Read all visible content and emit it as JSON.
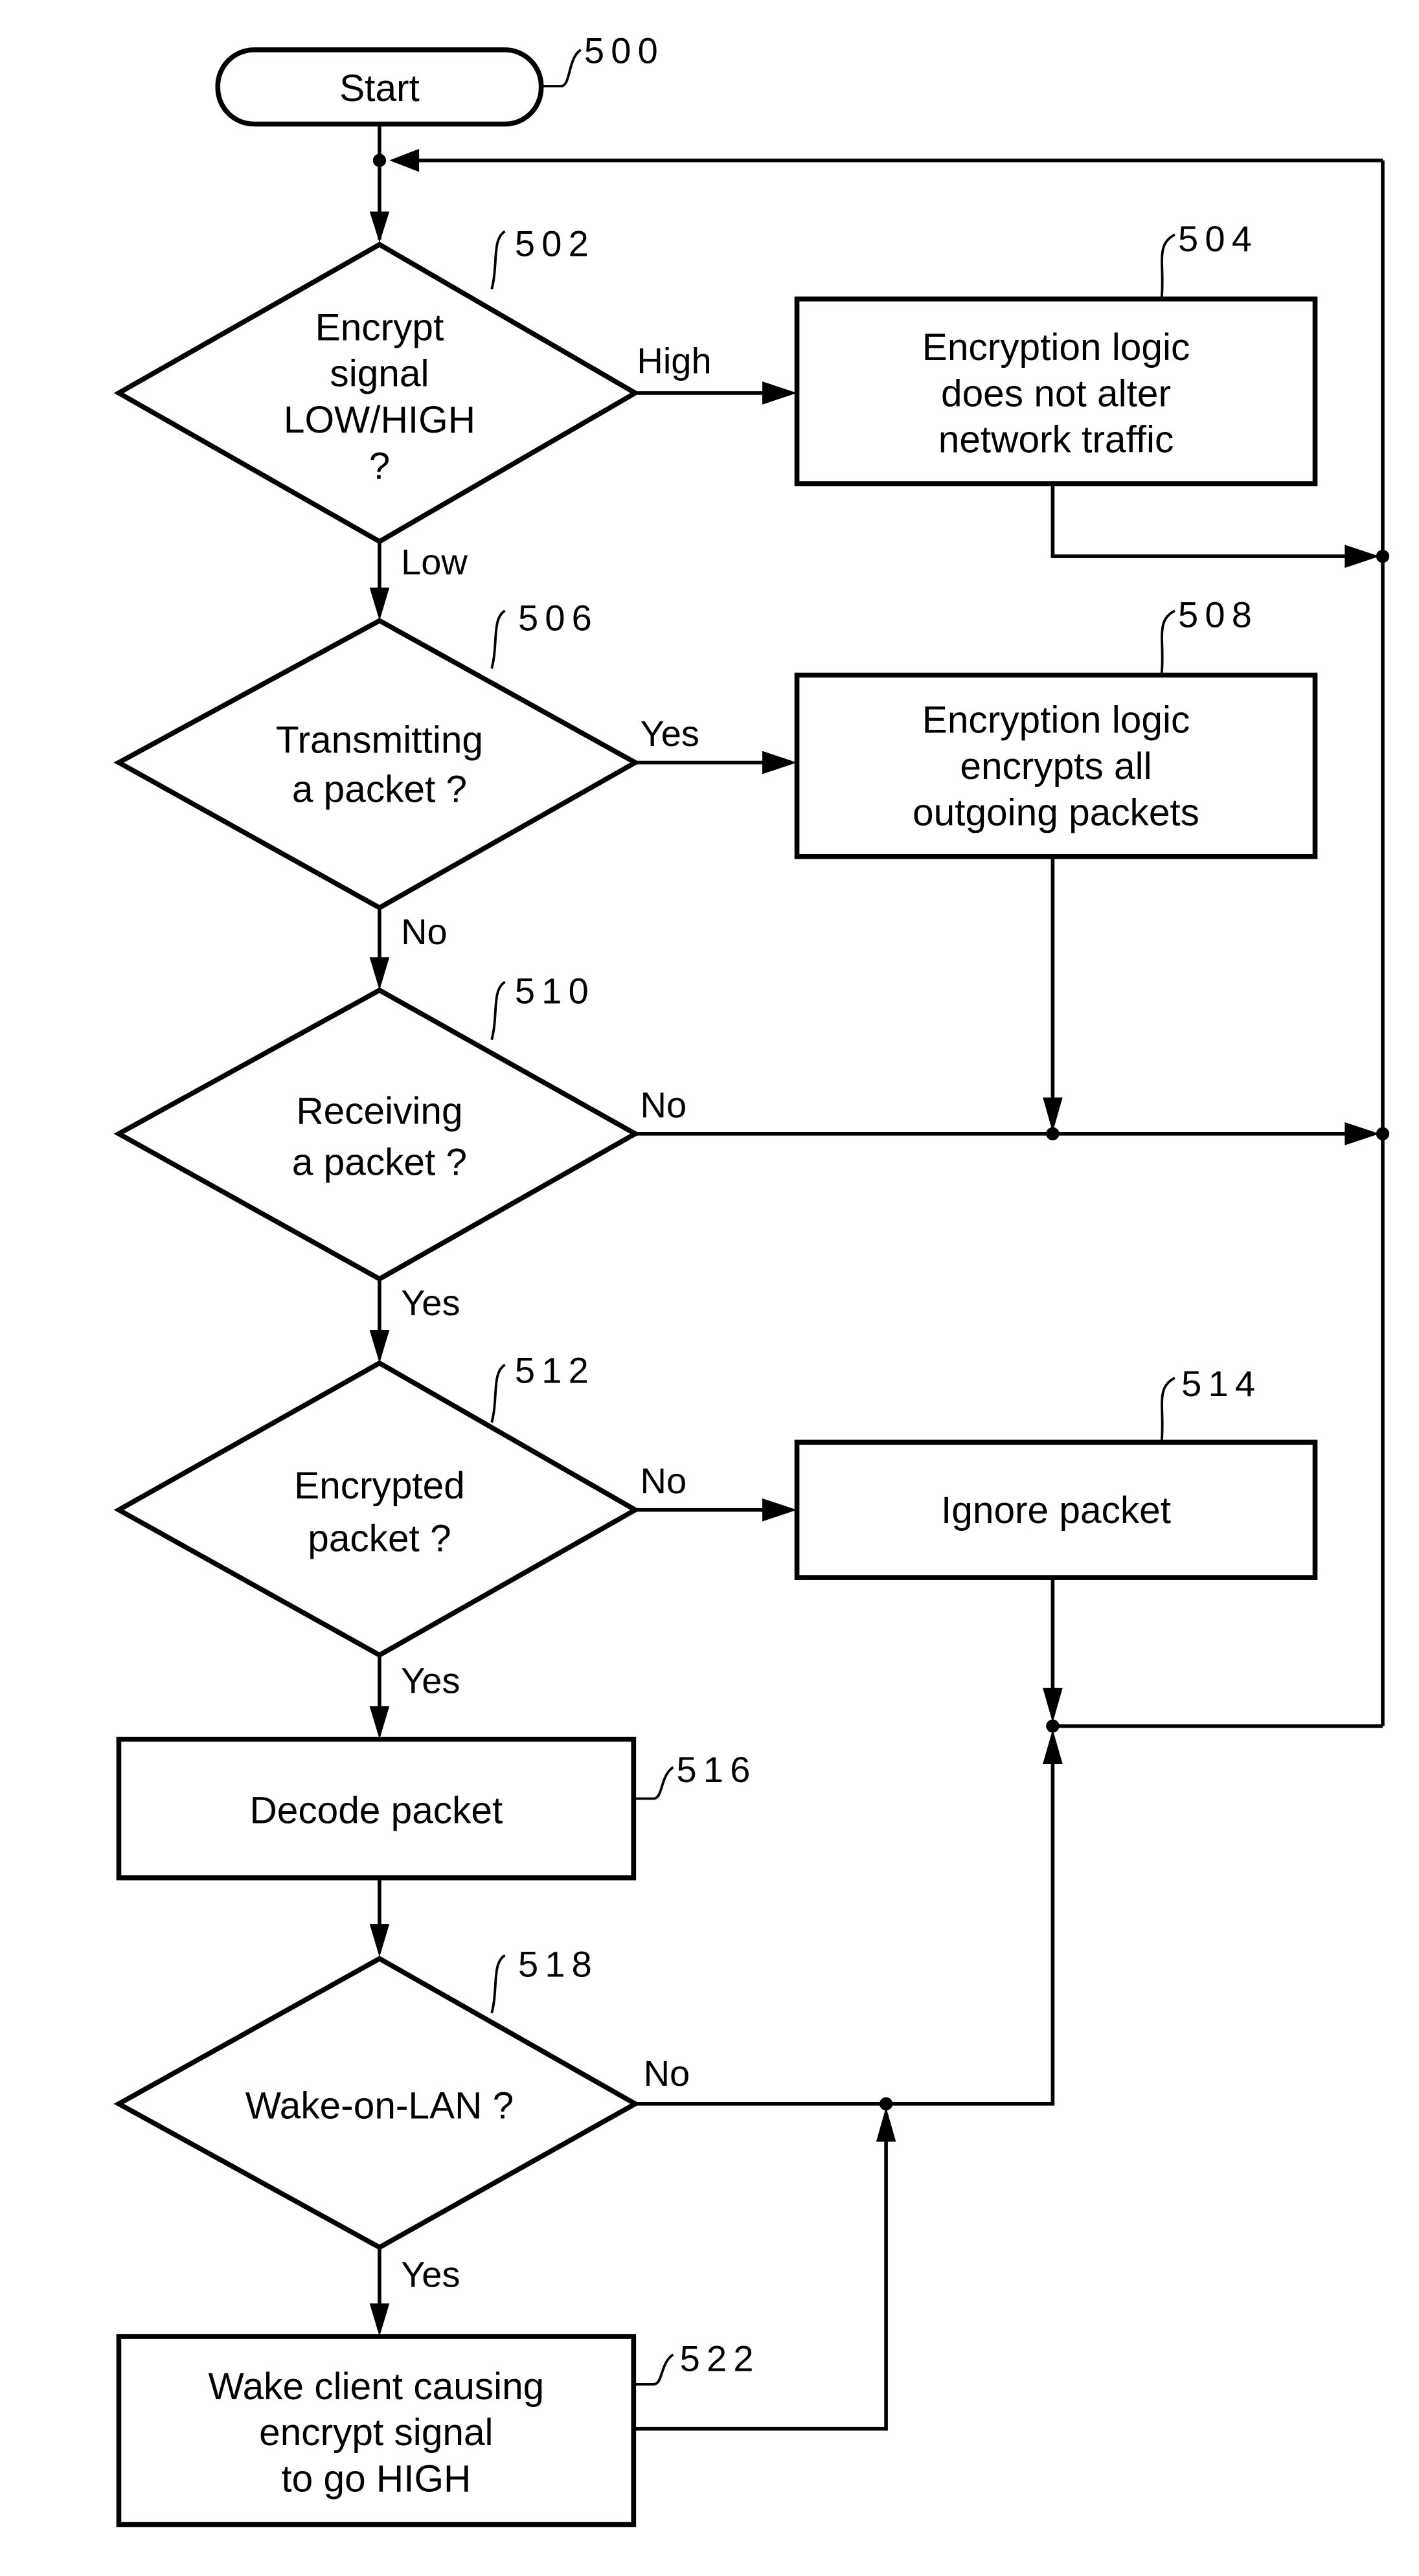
{
  "title": "Encryption / Wake-on-LAN flowchart",
  "nodes": {
    "start": {
      "ref": "500",
      "lines": [
        "Start"
      ]
    },
    "d502": {
      "ref": "502",
      "lines": [
        "Encrypt",
        "signal",
        "LOW/HIGH",
        "?"
      ]
    },
    "b504": {
      "ref": "504",
      "lines": [
        "Encryption logic",
        "does not alter",
        "network traffic"
      ]
    },
    "d506": {
      "ref": "506",
      "lines": [
        "Transmitting",
        "a packet ?"
      ]
    },
    "b508": {
      "ref": "508",
      "lines": [
        "Encryption logic",
        "encrypts all",
        "outgoing packets"
      ]
    },
    "d510": {
      "ref": "510",
      "lines": [
        "Receiving",
        "a packet ?"
      ]
    },
    "d512": {
      "ref": "512",
      "lines": [
        "Encrypted",
        "packet ?"
      ]
    },
    "b514": {
      "ref": "514",
      "lines": [
        "Ignore packet"
      ]
    },
    "b516": {
      "ref": "516",
      "lines": [
        "Decode packet"
      ]
    },
    "d518": {
      "ref": "518",
      "lines": [
        "Wake-on-LAN ?"
      ]
    },
    "b522": {
      "ref": "522",
      "lines": [
        "Wake client causing",
        "encrypt signal",
        "to go HIGH"
      ]
    }
  },
  "edge_labels": {
    "high": "High",
    "low": "Low",
    "yes_506": "Yes",
    "no_506": "No",
    "no_510": "No",
    "yes_510": "Yes",
    "no_512": "No",
    "yes_512": "Yes",
    "no_518": "No",
    "yes_518": "Yes"
  }
}
